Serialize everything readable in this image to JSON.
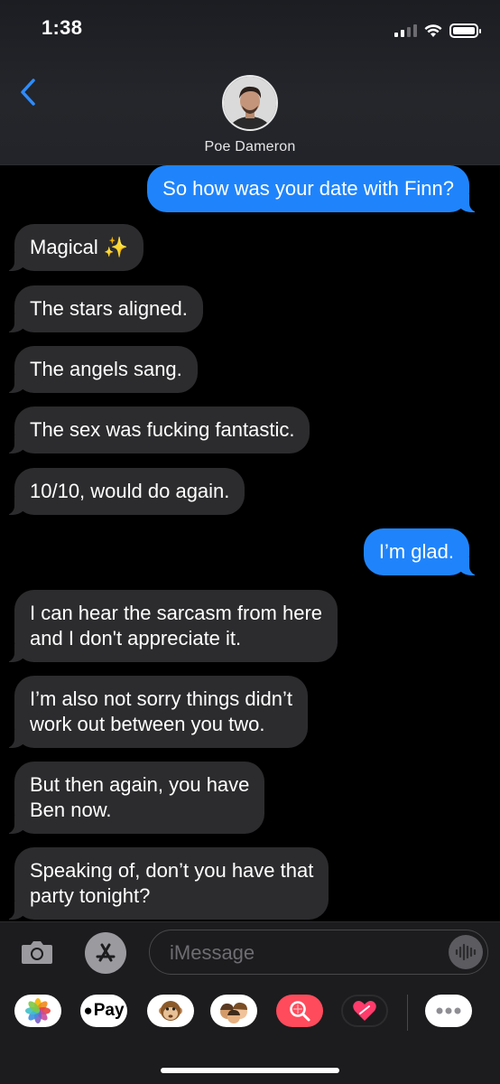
{
  "status_bar": {
    "time": "1:38"
  },
  "header": {
    "contact_name": "Poe Dameron",
    "back_icon": "chevron-left-icon",
    "avatar": "contact-photo"
  },
  "messages": [
    {
      "from": "me",
      "text": "So how was your date with Finn?"
    },
    {
      "from": "them",
      "text": "Magical ✨"
    },
    {
      "from": "them",
      "text": "The stars aligned."
    },
    {
      "from": "them",
      "text": "The angels sang."
    },
    {
      "from": "them",
      "text": "The sex was fucking fantastic."
    },
    {
      "from": "them",
      "text": "10/10, would do again."
    },
    {
      "from": "me",
      "text": "I’m glad."
    },
    {
      "from": "them",
      "text": "I can hear the sarcasm from here\nand I don't appreciate it."
    },
    {
      "from": "them",
      "text": "I’m also not sorry things didn’t\nwork out between you two."
    },
    {
      "from": "them",
      "text": "But then again, you have\nBen now."
    },
    {
      "from": "them",
      "text": "Speaking of, don’t you have that\nparty tonight?"
    }
  ],
  "composer": {
    "placeholder": "iMessage",
    "camera_icon": "camera-icon",
    "appstore_icon": "app-store-icon",
    "mic_icon": "audio-waveform-icon"
  },
  "app_drawer": {
    "items": [
      "photos-icon",
      "Pay",
      "animoji-monkey-icon",
      "memoji-icon",
      "search-images-icon",
      "digital-touch-icon",
      "more-icon"
    ]
  },
  "colors": {
    "outgoing": "#1f84fb",
    "incoming": "#2c2c2e",
    "back_chevron": "#2f8cff"
  }
}
